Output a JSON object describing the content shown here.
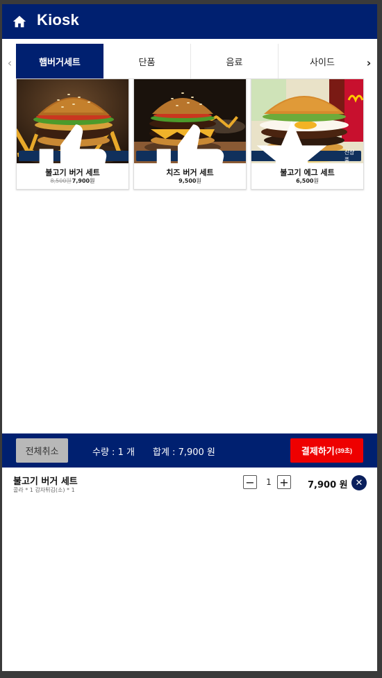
{
  "header": {
    "title": "Kiosk",
    "icon": "home-icon"
  },
  "tabs": [
    {
      "label": "햄버거세트",
      "active": true
    },
    {
      "label": "단품",
      "active": false
    },
    {
      "label": "음료",
      "active": false
    },
    {
      "label": "사이드",
      "active": false
    }
  ],
  "nav": {
    "prev": "‹",
    "next": "›"
  },
  "products": [
    {
      "name": "불고기 버거 세트",
      "old_price": "8,500원",
      "price": "7,900",
      "unit": "원",
      "badge": "추천",
      "badge_icon": "thumbs-up-icon"
    },
    {
      "name": "치즈 버거 세트",
      "price": "9,500",
      "unit": "원",
      "badge": "추천",
      "badge_icon": "thumbs-up-icon"
    },
    {
      "name": "불고기 에그 세트",
      "price": "6,500",
      "unit": "원",
      "badge": "신상품",
      "badge_icon": "star-icon"
    }
  ],
  "cart_bar": {
    "cancel_label": "전체취소",
    "quantity_text": "수량 : 1 개",
    "total_text": "합계 : 7,900 원",
    "pay_label": "결제하기",
    "pay_timer": "(39초)"
  },
  "order_items": [
    {
      "name": "불고기 버거 세트",
      "options": "콜라 * 1  감자튀김(소) * 1",
      "qty": "1",
      "price": "7,900 원",
      "minus": "−",
      "plus": "+",
      "remove": "✕"
    }
  ],
  "colors": {
    "primary": "#002070",
    "pay": "#ee0000",
    "cancel": "#b8b8b8"
  }
}
